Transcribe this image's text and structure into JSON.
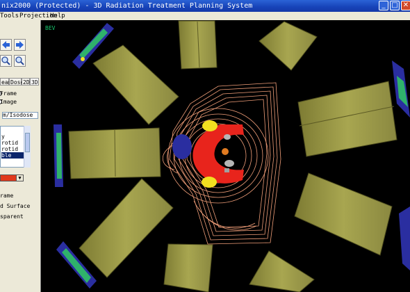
{
  "window": {
    "title": "nix2000 (Protected) - 3D Radiation Treatment Planning System",
    "minimize": "_",
    "maximize": "□",
    "close": "✕"
  },
  "menu": [
    "Tools",
    "Projection",
    "Help"
  ],
  "left_panel": {
    "tabs": [
      "eam",
      "Dose",
      "2D",
      "3D"
    ],
    "options_1": [
      "Frame",
      "Image"
    ],
    "dropdown_value": "m/Isodose",
    "list_items": [
      "y",
      "rotid",
      "rotid",
      "ble",
      ""
    ],
    "selected_index": 3,
    "color_swatch": "#e0391c",
    "options_2": [
      "rame",
      "d Surface",
      "sparent"
    ]
  },
  "viewport": {
    "label": "BEV",
    "background": "#000000"
  },
  "colors": {
    "titlebar": "#1743b8",
    "beam_blocks": "#9c9a45",
    "isodose_lines": "#f3a07a",
    "target": "#e8241c",
    "collimator": "#2a2ea0"
  }
}
